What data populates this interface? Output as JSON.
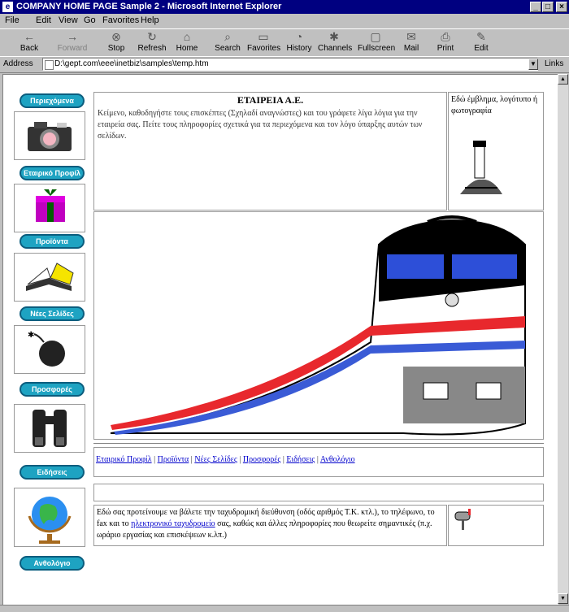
{
  "window": {
    "title": "COMPANY HOME PAGE Sample 2 - Microsoft Internet Explorer"
  },
  "menu": [
    "File",
    "Edit",
    "View",
    "Go",
    "Favorites",
    "Help"
  ],
  "toolbar": {
    "back": "Back",
    "forward": "Forward",
    "stop": "Stop",
    "refresh": "Refresh",
    "home": "Home",
    "search": "Search",
    "favorites": "Favorites",
    "history": "History",
    "channels": "Channels",
    "fullscreen": "Fullscreen",
    "mail": "Mail",
    "print": "Print",
    "edit": "Edit"
  },
  "address": {
    "label": "Address",
    "value": "D:\\gept.com\\eee\\inetbiz\\samples\\temp.htm",
    "links": "Links"
  },
  "nav": [
    {
      "label": "Περιεχόμενα",
      "icon": "camera-icon"
    },
    {
      "label": "Εταιρικό Προφίλ",
      "icon": "gift-icon"
    },
    {
      "label": "Προϊόντα",
      "icon": "book-icon"
    },
    {
      "label": "Νέες Σελίδες",
      "icon": "bomb-icon"
    },
    {
      "label": "Προσφορές",
      "icon": "binoculars-icon"
    },
    {
      "label": "Ειδήσεις",
      "icon": "globe-icon"
    },
    {
      "label": "Ανθολόγιο",
      "icon": ""
    }
  ],
  "header": {
    "title": "ΕΤΑΙΡΕΙΑ Α.Ε.",
    "intro": "Κείμενο, καθοδηγήστε τους επισκέπτες (Σχηλαδί αναγνώστες) και του γράφετε λίγα λόγια για την εταιρεία σας. Πείτε τους πληροφορίες σχετικά για τα περιεχόμενα και τον λόγο ύπαρξης αυτών των σελίδων.",
    "logo_text": "Εδώ έμβλημα, λογότυπο ή φωτογραφία"
  },
  "nav_links": [
    "Εταιρικό Προφίλ",
    "Προϊόντα",
    "Νέες Σελίδες",
    "Προσφορές",
    "Ειδήσεις",
    "Ανθολόγιο"
  ],
  "contact": {
    "text_before": "Εδώ σας προτείνουμε να βάλετε την ταχυδρομική διεύθυνση (οδός αριθμός Τ.Κ. κτλ.), το τηλέφωνο, το fax και το ",
    "email_link": "ηλεκτρονικό ταχυδρομείο",
    "text_after": " σας, καθώς και άλλες πληροφορίες που θεωρείτε σημαντικές (π.χ. ωράριο εργασίας και επισκέψεων κ.λπ.)"
  },
  "colors": {
    "nav_button": "#1ea3c2",
    "titlebar": "#000080",
    "link": "#0000cc"
  }
}
